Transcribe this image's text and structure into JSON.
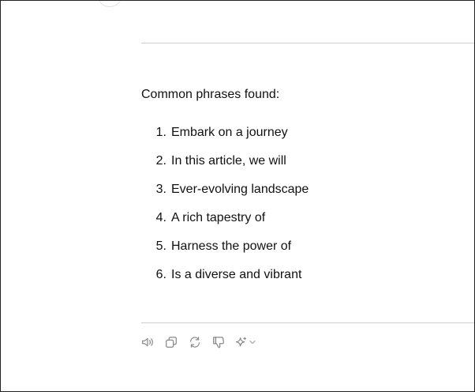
{
  "message": {
    "intro": "Common phrases found:",
    "phrases": [
      {
        "num": "1.",
        "text": "Embark on a journey"
      },
      {
        "num": "2.",
        "text": "In this article, we will"
      },
      {
        "num": "3.",
        "text": "Ever-evolving landscape"
      },
      {
        "num": "4.",
        "text": "A rich tapestry of"
      },
      {
        "num": "5.",
        "text": "Harness the power of"
      },
      {
        "num": "6.",
        "text": "Is a diverse and vibrant"
      }
    ]
  },
  "actions": [
    {
      "icon": "speaker-icon"
    },
    {
      "icon": "copy-icon"
    },
    {
      "icon": "regenerate-icon"
    },
    {
      "icon": "thumbs-down-icon"
    },
    {
      "icon": "sparkle-icon"
    }
  ],
  "colors": {
    "text": "#111111",
    "icon": "#8a8a8a",
    "divider": "#cfcfcf"
  }
}
